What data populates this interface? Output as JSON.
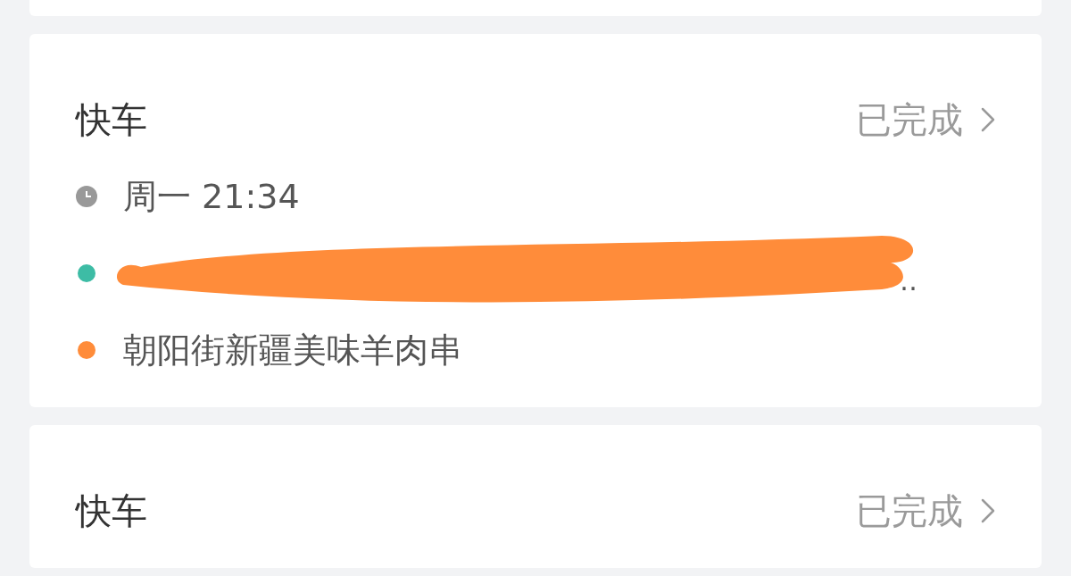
{
  "orders": [
    {
      "type": "快车",
      "status": "已完成",
      "time": "周一 21:34",
      "stops": [
        {
          "color": "#3dbca5",
          "redacted": true,
          "text": "‥"
        },
        {
          "color": "#ff8c3a",
          "redacted": false,
          "text": "朝阳街新疆美味羊肉串"
        }
      ]
    },
    {
      "type": "快车",
      "status": "已完成"
    }
  ]
}
